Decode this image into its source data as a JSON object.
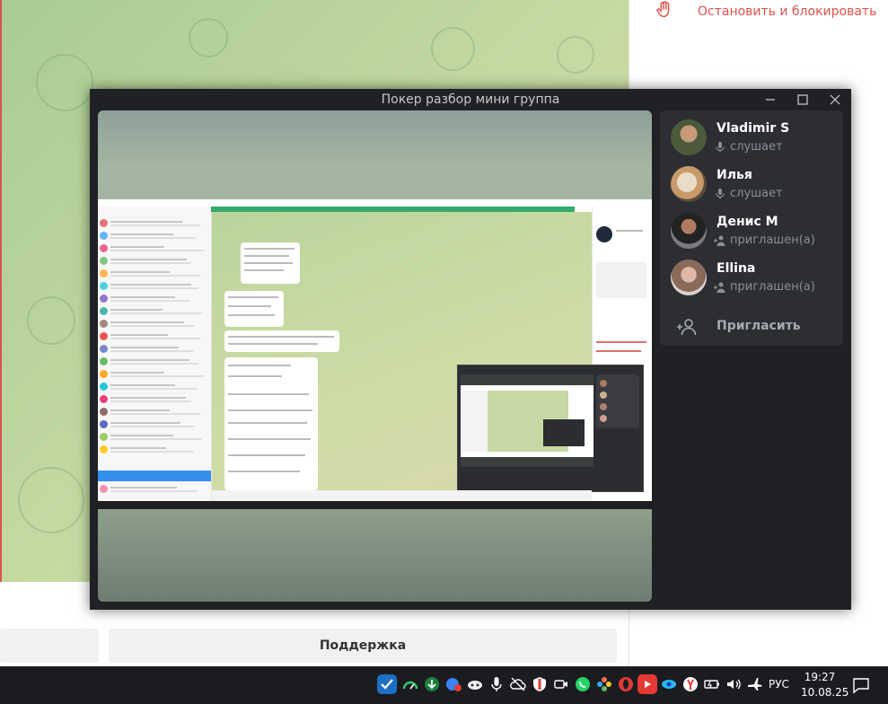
{
  "background_window": {
    "block_action_label": "Остановить и блокировать",
    "support_button_label": "Поддержка"
  },
  "call_window": {
    "title": "Покер разбор мини группа",
    "participants": [
      {
        "name": "Vladimir S",
        "status": "слушает",
        "status_icon": "mic-muted-icon"
      },
      {
        "name": "Илья",
        "status": "слушает",
        "status_icon": "mic-muted-icon"
      },
      {
        "name": "Денис М",
        "status": "приглашен(а)",
        "status_icon": "person-add-icon"
      },
      {
        "name": "Ellina",
        "status": "приглашен(а)",
        "status_icon": "person-add-icon"
      }
    ],
    "invite_label": "Пригласить"
  },
  "taskbar": {
    "language": "РУС",
    "time": "19:27",
    "date": "10.08.25"
  },
  "colors": {
    "call_bg": "#202124",
    "panel_bg": "#2c2e33",
    "danger": "#e0514c",
    "taskbar_bg": "#1a1c20"
  }
}
